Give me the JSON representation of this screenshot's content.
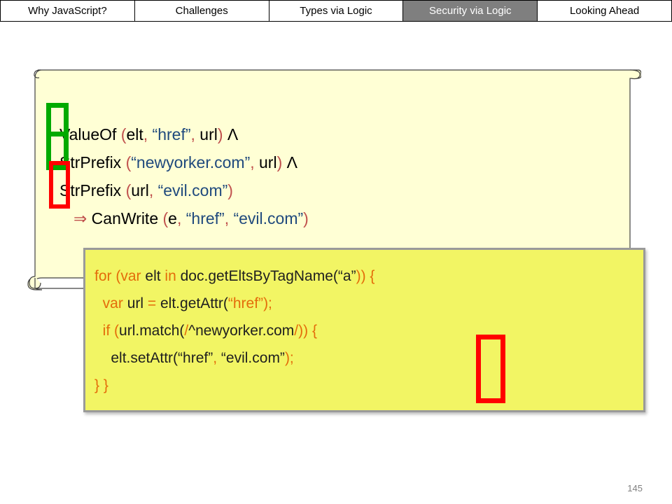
{
  "nav": {
    "tabs": [
      {
        "label": "Why JavaScript?",
        "active": false
      },
      {
        "label": "Challenges",
        "active": false
      },
      {
        "label": "Types via Logic",
        "active": false
      },
      {
        "label": "Security via Logic",
        "active": true
      },
      {
        "label": "Looking Ahead",
        "active": false
      }
    ]
  },
  "logic": {
    "line1": {
      "fn": "ValueOf",
      "open": "(",
      "a1": "elt",
      "c1": ",",
      "s1": "“href”",
      "c2": ",",
      "a2": "url",
      "close": ")",
      "op": "Λ"
    },
    "line2": {
      "fn": "StrPrefix",
      "open": "(",
      "s1": "“newyorker.com”",
      "c1": ",",
      "a1": "url",
      "close": ")",
      "op": "Λ"
    },
    "line3": {
      "fn": "StrPrefix",
      "open": "(",
      "a1": "url",
      "c1": ",",
      "s1": "“evil.com”",
      "close": ")"
    },
    "line4": {
      "implies": "⇒",
      "fn": "CanWrite",
      "open": "(",
      "a1": "e",
      "c1": ",",
      "s1": "“href”",
      "c2": ",",
      "s2": "“evil.com”",
      "close": ")"
    }
  },
  "code": {
    "line1": {
      "kw1": "for",
      "p1": "(",
      "kw2": "var",
      "t1": "elt",
      "kw3": "in",
      "t2": "doc.getEltsByTagName(",
      "s1": "“a”",
      "p2": ")) {"
    },
    "line2": {
      "kw1": "var",
      "t1": "url",
      "p1": "=",
      "t2": "elt.getAttr(",
      "s1": "“href”",
      "p2": ");"
    },
    "line3": {
      "kw1": "if",
      "p1": "(",
      "t1": "url.match(",
      "p2": "/",
      "t2": "^newyorker.com",
      "p3": "/",
      "p4": ")) {"
    },
    "line4": {
      "t1": "elt.setAttr(",
      "s1": "“href”",
      "p1": ",",
      "s2": "“evil.com”",
      "p2": ");"
    },
    "line5": {
      "p1": "} }"
    }
  },
  "page_number": "145",
  "colors": {
    "active_tab": "#7f7f7f",
    "scroll_bg": "#ffffd5",
    "code_bg": "#f2f564",
    "check_green": "#00aa00",
    "cross_red": "#ff0000"
  }
}
